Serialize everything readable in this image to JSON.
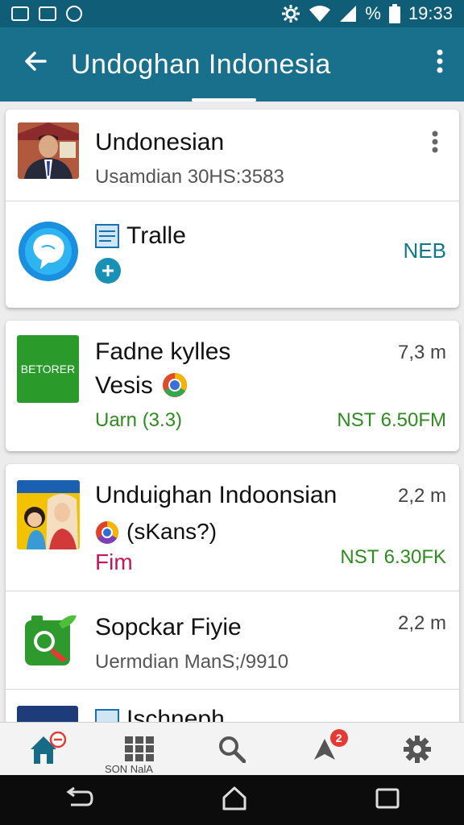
{
  "status": {
    "battery_pct": "%",
    "time": "19:33"
  },
  "appbar": {
    "title": "Undoghan Indonesia"
  },
  "cards": [
    {
      "rows": [
        {
          "name": "Undonesian",
          "sub": "Usamdian 30HS:3583"
        },
        {
          "name": "Tralle",
          "meta": "NEB"
        }
      ]
    },
    {
      "rows": [
        {
          "thumb_label": "BETORER",
          "name": "Fadne kylles",
          "name2": "Vesis",
          "sub": "Uarn (3.3)",
          "meta_top": "7,3 m",
          "meta_bottom": "NST 6.50FM"
        }
      ]
    },
    {
      "rows": [
        {
          "name": "Unduighan Indoonsian",
          "sub": "(sKans?)",
          "sub2": "Fim",
          "meta_top": "2,2 m",
          "meta_bottom": "NST 6.30FK"
        },
        {
          "name": "Sopckar Fiyie",
          "sub": "Uermdian ManS;/9910",
          "meta_top": "2,2 m"
        },
        {
          "name": "Ischneph"
        }
      ]
    }
  ],
  "bottom_nav": {
    "badge_count": "2",
    "caption": "SON NalA"
  },
  "colors": {
    "primary": "#18708c",
    "status_bar": "#0f5d77",
    "accent_text": "#11788c",
    "green": "#2e8b1f",
    "badge": "#e53935"
  }
}
